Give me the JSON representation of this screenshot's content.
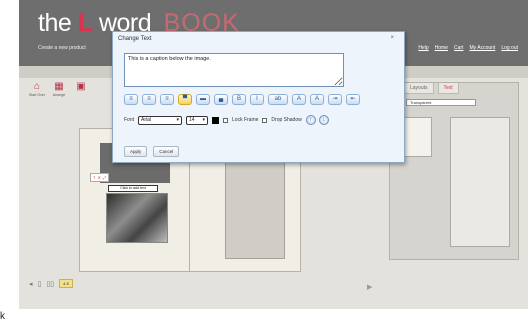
{
  "header": {
    "logo_the": "the",
    "logo_l": "L",
    "logo_word": "word",
    "logo_book": "BOOK",
    "tagline": "Create a new product",
    "nav": [
      "Help",
      "Home",
      "Cart",
      "My Account",
      "Log out"
    ]
  },
  "toolbar": {
    "tools": [
      {
        "icon": "home-icon",
        "glyph": "⌂",
        "label": "Start Over"
      },
      {
        "icon": "arrange-icon",
        "glyph": "▦",
        "label": "Arrange"
      },
      {
        "icon": "tool-icon",
        "glyph": "▣",
        "label": ""
      }
    ]
  },
  "canvas": {
    "caption_preview": "Click to add text",
    "mini_tools": [
      "T",
      "✕",
      "⤢"
    ]
  },
  "side_panel": {
    "tabs": [
      "Layouts",
      "Text"
    ],
    "active_tab": "Text",
    "transparency": "Transparent"
  },
  "bottom": {
    "page_label": "4-5"
  },
  "dialog": {
    "title": "Change Text",
    "close": "×",
    "caption_text": "This is a caption below the image.",
    "format_buttons": [
      {
        "name": "align-left-button",
        "glyph": "≡"
      },
      {
        "name": "align-center-button",
        "glyph": "≡"
      },
      {
        "name": "align-right-button",
        "glyph": "≡"
      },
      {
        "name": "align-top-button",
        "glyph": "▀"
      },
      {
        "name": "align-middle-button",
        "glyph": "▬"
      },
      {
        "name": "align-bottom-button",
        "glyph": "▄"
      },
      {
        "name": "bold-button",
        "glyph": "B"
      },
      {
        "name": "italic-button",
        "glyph": "I"
      },
      {
        "name": "text-spacing-button",
        "glyph": "ab"
      },
      {
        "name": "size-up-button",
        "glyph": "A"
      },
      {
        "name": "size-down-button",
        "glyph": "A"
      },
      {
        "name": "indent-button",
        "glyph": "⇥"
      },
      {
        "name": "outdent-button",
        "glyph": "⇤"
      }
    ],
    "font_label": "Font",
    "font_value": "Arial",
    "size_value": "14",
    "text_color": "#000000",
    "lock_frame_label": "Lock Frame",
    "drop_shadow_label": "Drop Shadow",
    "apply_label": "Apply",
    "cancel_label": "Cancel"
  }
}
